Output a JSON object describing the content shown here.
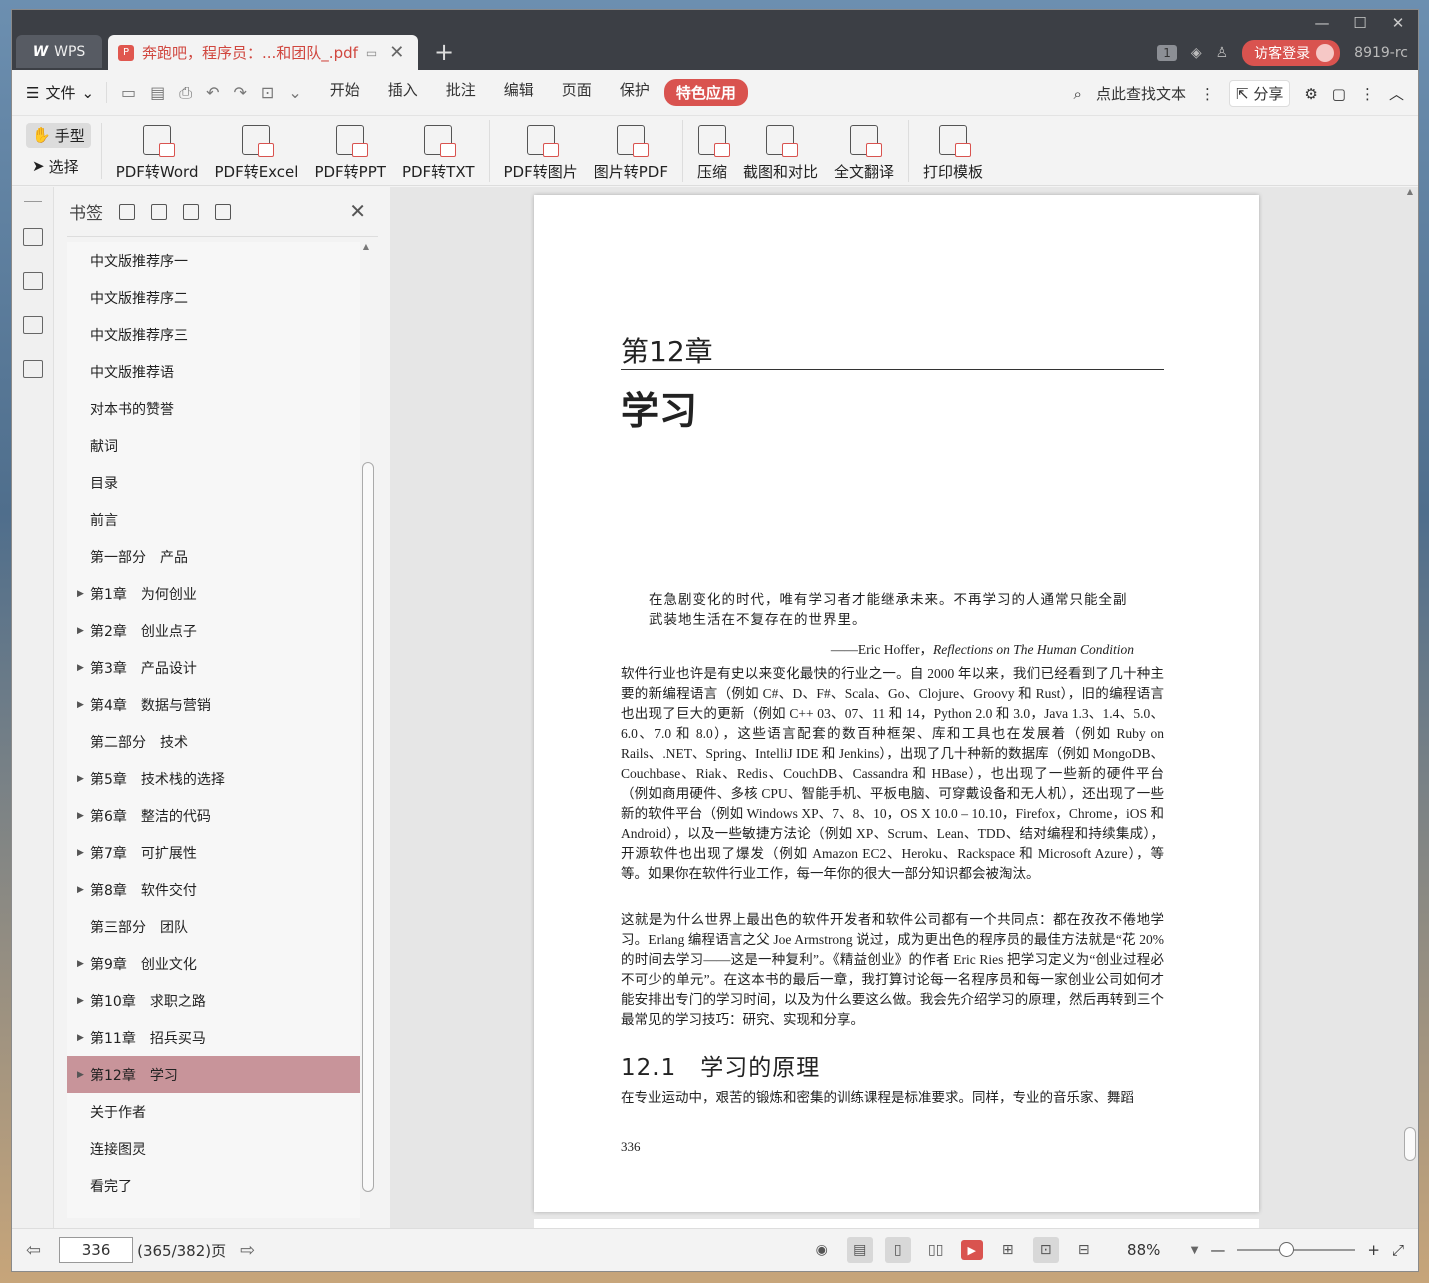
{
  "tabs": {
    "wps_label": "WPS",
    "document_title": "奔跑吧，程序员：...和团队_.pdf"
  },
  "title_right": {
    "count_badge": "1",
    "login_label": "访客登录",
    "user_id": "8919-rc"
  },
  "menu": {
    "file_label": "文件",
    "tabs": [
      "开始",
      "插入",
      "批注",
      "编辑",
      "页面",
      "保护",
      "特色应用"
    ],
    "active_tab": "特色应用",
    "search_label": "点此查找文本",
    "share_label": "分享"
  },
  "ribbon": {
    "hand_label": "手型",
    "select_label": "选择",
    "buttons": [
      "PDF转Word",
      "PDF转Excel",
      "PDF转PPT",
      "PDF转TXT",
      "PDF转图片",
      "图片转PDF",
      "压缩",
      "截图和对比",
      "全文翻译",
      "打印模板"
    ]
  },
  "bookmarks": {
    "title": "书签",
    "items": [
      {
        "label": "中文版推荐序一",
        "expandable": false
      },
      {
        "label": "中文版推荐序二",
        "expandable": false
      },
      {
        "label": "中文版推荐序三",
        "expandable": false
      },
      {
        "label": "中文版推荐语",
        "expandable": false
      },
      {
        "label": "对本书的赞誉",
        "expandable": false
      },
      {
        "label": "献词",
        "expandable": false
      },
      {
        "label": "目录",
        "expandable": false
      },
      {
        "label": "前言",
        "expandable": false
      },
      {
        "label": "第一部分　产品",
        "expandable": false
      },
      {
        "label": "第1章　为何创业",
        "expandable": true
      },
      {
        "label": "第2章　创业点子",
        "expandable": true
      },
      {
        "label": "第3章　产品设计",
        "expandable": true
      },
      {
        "label": "第4章　数据与营销",
        "expandable": true
      },
      {
        "label": "第二部分　技术",
        "expandable": false
      },
      {
        "label": "第5章　技术栈的选择",
        "expandable": true
      },
      {
        "label": "第6章　整洁的代码",
        "expandable": true
      },
      {
        "label": "第7章　可扩展性",
        "expandable": true
      },
      {
        "label": "第8章　软件交付",
        "expandable": true
      },
      {
        "label": "第三部分　团队",
        "expandable": false
      },
      {
        "label": "第9章　创业文化",
        "expandable": true
      },
      {
        "label": "第10章　求职之路",
        "expandable": true
      },
      {
        "label": "第11章　招兵买马",
        "expandable": true
      },
      {
        "label": "第12章　学习",
        "expandable": true,
        "selected": true
      },
      {
        "label": "关于作者",
        "expandable": false
      },
      {
        "label": "连接图灵",
        "expandable": false
      },
      {
        "label": "看完了",
        "expandable": false
      }
    ]
  },
  "page": {
    "chapter_number": "第12章",
    "chapter_title": "学习",
    "epigraph": "在急剧变化的时代，唯有学习者才能继承未来。不再学习的人通常只能全副武装地生活在不复存在的世界里。",
    "epigraph_author": "——Eric Hoffer，",
    "epigraph_book": "Reflections on The Human Condition",
    "paragraph1": "软件行业也许是有史以来变化最快的行业之一。自 2000 年以来，我们已经看到了几十种主要的新编程语言（例如 C#、D、F#、Scala、Go、Clojure、Groovy 和 Rust），旧的编程语言也出现了巨大的更新（例如 C++ 03、07、11 和 14，Python 2.0 和 3.0，Java 1.3、1.4、5.0、6.0、7.0 和 8.0），这些语言配套的数百种框架、库和工具也在发展着（例如 Ruby on Rails、.NET、Spring、IntelliJ IDE 和 Jenkins），出现了几十种新的数据库（例如 MongoDB、Couchbase、Riak、Redis、CouchDB、Cassandra 和 HBase），也出现了一些新的硬件平台（例如商用硬件、多核 CPU、智能手机、平板电脑、可穿戴设备和无人机），还出现了一些新的软件平台（例如 Windows XP、7、8、10，OS X 10.0 – 10.10，Firefox，Chrome，iOS 和 Android），以及一些敏捷方法论（例如 XP、Scrum、Lean、TDD、结对编程和持续集成），开源软件也出现了爆发（例如 Amazon EC2、Heroku、Rackspace 和 Microsoft Azure），等等。如果你在软件行业工作，每一年你的很大一部分知识都会被淘汰。",
    "paragraph2": "这就是为什么世界上最出色的软件开发者和软件公司都有一个共同点：都在孜孜不倦地学习。Erlang 编程语言之父 Joe Armstrong 说过，成为更出色的程序员的最佳方法就是“花 20% 的时间去学习——这是一种复利”。《精益创业》的作者 Eric Ries 把学习定义为“创业过程必不可少的单元”。在这本书的最后一章，我打算讨论每一名程序员和每一家创业公司如何才能安排出专门的学习时间，以及为什么要这么做。我会先介绍学习的原理，然后再转到三个最常见的学习技巧：研究、实现和分享。",
    "section_heading": "12.1　学习的原理",
    "paragraph3": "在专业运动中，艰苦的锻炼和密集的训练课程是标准要求。同样，专业的音乐家、舞蹈",
    "page_number": "336"
  },
  "status": {
    "current_page": "336",
    "page_total": "(365/382)页",
    "zoom": "88%"
  },
  "colors": {
    "accent": "#d9534f",
    "selected_bookmark": "#c8949a",
    "titlebar": "#3c3f45"
  }
}
